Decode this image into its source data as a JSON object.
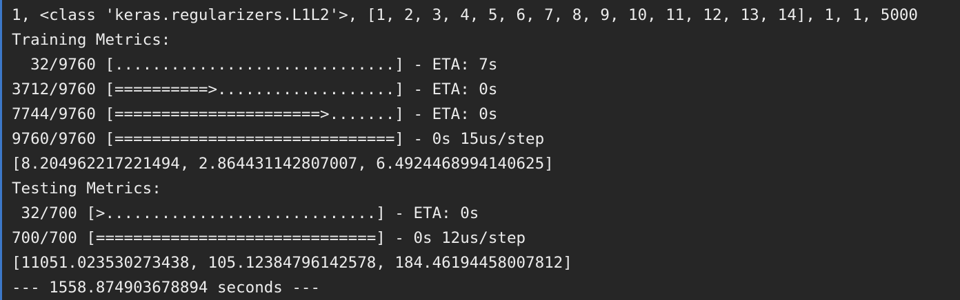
{
  "terminal": {
    "lines": [
      "1, <class 'keras.regularizers.L1L2'>, [1, 2, 3, 4, 5, 6, 7, 8, 9, 10, 11, 12, 13, 14], 1, 1, 5000",
      "Training Metrics:",
      "  32/9760 [..............................] - ETA: 7s",
      "3712/9760 [==========>...................] - ETA: 0s",
      "7744/9760 [======================>.......] - ETA: 0s",
      "9760/9760 [==============================] - 0s 15us/step",
      "[8.204962217221494, 2.864431142807007, 6.4924468994140625]",
      "Testing Metrics:",
      " 32/700 [>.............................] - ETA: 0s",
      "700/700 [==============================] - 0s 12us/step",
      "[11051.023530273438, 105.12384796142578, 184.46194458007812]",
      "--- 1558.874903678894 seconds ---"
    ]
  }
}
